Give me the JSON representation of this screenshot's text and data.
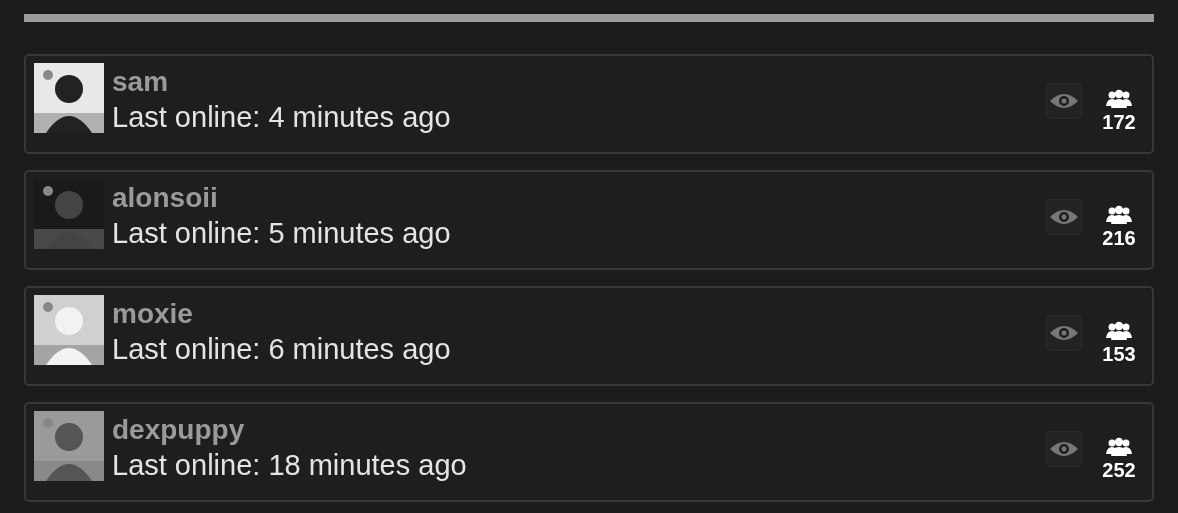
{
  "users": [
    {
      "name": "sam",
      "status": "Last online: 4 minutes ago",
      "count": "172"
    },
    {
      "name": "alonsoii",
      "status": "Last online: 5 minutes ago",
      "count": "216"
    },
    {
      "name": "moxie",
      "status": "Last online: 6 minutes ago",
      "count": "153"
    },
    {
      "name": "dexpuppy",
      "status": "Last online: 18 minutes ago",
      "count": "252"
    }
  ]
}
